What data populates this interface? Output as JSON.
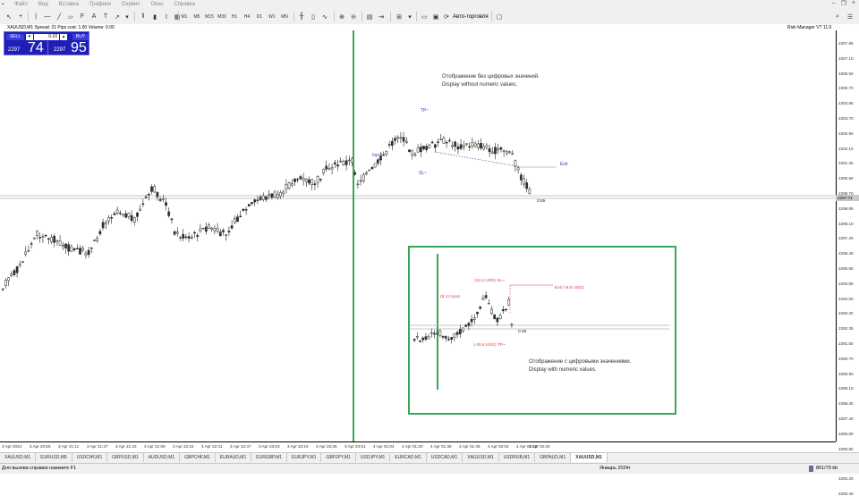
{
  "menubar": {
    "items": [
      "Файл",
      "Вид",
      "Вставка",
      "Графики",
      "Сервис",
      "Окно",
      "Справка"
    ]
  },
  "toolbar": {
    "timeframes": [
      "M1",
      "M5",
      "M15",
      "M30",
      "H1",
      "H4",
      "D1",
      "W1",
      "MN"
    ],
    "auto_trading": "Авто-торговля"
  },
  "chart": {
    "symbol_info": "XAUUSD,M1    Spread: 21    Pips cost: 1.00    Volume: 0.00",
    "indicator_label": "Risk Manager VT 11.0",
    "trade_panel": {
      "sell": "SELL",
      "buy": "BUY",
      "lot": "0.10",
      "sell_small": "2297",
      "sell_big": "74",
      "buy_small": "2297",
      "buy_big": "95"
    },
    "annotations": {
      "top_ru": "Отображение без цифровых значений.",
      "top_en": "Display without numeric values.",
      "tp": "TP~",
      "input": "Input",
      "sl": "SL~",
      "exit": "Exit",
      "timer": "0:55",
      "bottom_ru": "Отображение с цифровыми значениями.",
      "bottom_en": "Display with numeric values.",
      "sl_num": "(12.2 USD) SL~",
      "input_num": "(8.1) Input",
      "exit_num": "Exit (-9.8 USD)",
      "tp_num": "(-29.8 USD) TP~",
      "timer2": "0:48"
    },
    "current_price": "2297.74",
    "price_labels": [
      "2307.95",
      "2307.10",
      "2306.50",
      "2305.70",
      "2304.85",
      "2303.70",
      "2302.90",
      "2302.10",
      "2301.30",
      "2300.50",
      "2299.70",
      "2298.85",
      "2298.10",
      "2297.20",
      "2296.40",
      "2295.60",
      "2294.80",
      "2294.00",
      "2293.20",
      "2292.35",
      "2291.50",
      "2290.70",
      "2289.90",
      "2289.10",
      "2288.30",
      "2287.40",
      "2286.60",
      "2285.80",
      "2285.00",
      "2284.20",
      "2283.40"
    ],
    "time_labels": [
      "3 Apr 2024",
      "3 Apr 20:55",
      "3 Apr 21:11",
      "3 Apr 21:27",
      "3 Apr 21:43",
      "3 Apr 21:59",
      "3 Apr 22:15",
      "3 Apr 22:31",
      "3 Apr 22:47",
      "3 Apr 23:03",
      "3 Apr 23:19",
      "3 Apr 23:35",
      "3 Apr 23:51",
      "4 Apr 01:04",
      "4 Apr 01:20",
      "4 Apr 01:36",
      "4 Apr 01:46",
      "4 Apr 02:02",
      "4 Apr 02:18",
      "4 Apr 02:34"
    ]
  },
  "tabs": [
    "XAUUSD,M1",
    "EURUSD,M5",
    "USDCHF,M1",
    "GBPUSD,M1",
    "AUDUSD,M1",
    "GBPCHF,M1",
    "EURAUD,M1",
    "EURGBP,M1",
    "EURJPY,M1",
    "GBPJPY,M1",
    "USDJPY,M1",
    "EURCAD,M1",
    "USDCAD,M1",
    "XAGUSD,M1",
    "USDRUB,M1",
    "GBPAUD,M1",
    "XAUUSD,M1"
  ],
  "status": {
    "help": "Для вызова справки нажмите F1",
    "month": "Январь 2024г",
    "size": "861/79 kb"
  },
  "colors": {
    "trade_panel": "#1f1fb8",
    "inset_border": "#3aa653",
    "vertical_line": "#3aa653",
    "annotation_red": "#e23b3b",
    "annotation_blue": "#3c3ca8"
  }
}
